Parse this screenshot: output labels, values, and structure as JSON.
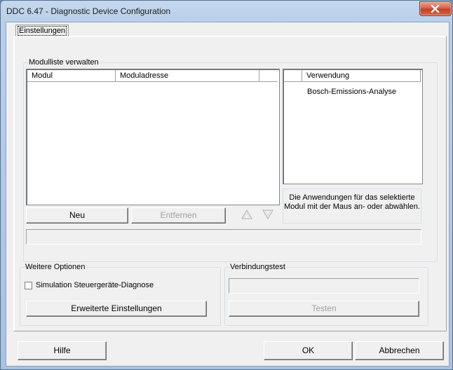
{
  "window": {
    "title": "DDC 6.47 - Diagnostic Device Configuration"
  },
  "tabs": [
    {
      "label": "Einstellungen",
      "selected": true
    }
  ],
  "modulliste": {
    "group_label": "Modulliste verwalten",
    "columns": [
      "Modul",
      "Moduladresse"
    ],
    "rows": [],
    "buttons": {
      "new": "Neu",
      "remove": "Entfernen"
    },
    "arrows": [
      "up-arrow-icon",
      "down-arrow-icon"
    ]
  },
  "verwendung": {
    "column": "Verwendung",
    "items": [
      "Bosch-Emissions-Analyse"
    ],
    "hint": "Die Anwendungen für das selektierte Modul mit der Maus an- oder abwählen."
  },
  "weitere_optionen": {
    "group_label": "Weitere Optionen",
    "checkbox_label": "Simulation Steuergeräte-Diagnose",
    "checkbox_checked": false,
    "advanced_button": "Erweiterte Einstellungen"
  },
  "verbindungstest": {
    "group_label": "Verbindungstest",
    "field_value": "",
    "test_button": "Testen"
  },
  "footer": {
    "help": "Hilfe",
    "ok": "OK",
    "cancel": "Abbrechen"
  },
  "colors": {
    "close_button": "#c7472b",
    "frame": "#b9cfe9",
    "dialog": "#f0f0f0"
  }
}
